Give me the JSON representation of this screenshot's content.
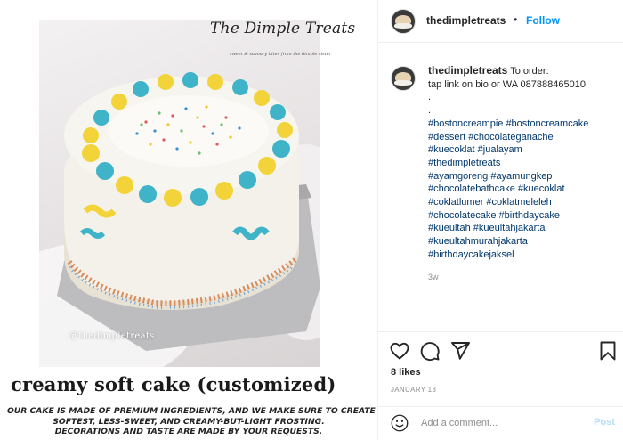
{
  "post_image": {
    "brand_name": "The Dimple Treats",
    "brand_tagline": "sweet & savoury bites from the dimple sister",
    "watermark": "@thedimpletreats",
    "caption_title": "creamy soft cake (customized)",
    "caption_lines": [
      "OUR CAKE IS MADE OF PREMIUM INGREDIENTS, AND WE MAKE SURE TO CREATE THE",
      "SOFTEST, LESS-SWEET, AND CREAMY-BUT-LIGHT FROSTING.",
      "DECORATIONS AND TASTE ARE MADE BY YOUR REQUESTS."
    ]
  },
  "header": {
    "username": "thedimpletreats",
    "separator": "•",
    "follow_label": "Follow"
  },
  "caption": {
    "username": "thedimpletreats",
    "text_lines": [
      "To order:",
      "tap link on bio or WA 087888465010",
      ".",
      ".",
      "#bostoncreampie #bostoncreamcake",
      "#dessert #chocolateganache",
      "#kuecoklat #jualayam",
      "#thedimpletreats",
      "#ayamgoreng #ayamungkep",
      "#chocolatebathcake #kuecoklat",
      "#coklatlumer #coklatmeleleh",
      "#chocolatecake #birthdaycake",
      "#kueultah #kueultahjakarta",
      "#kueultahmurahjakarta",
      "#birthdaycakejaksel"
    ],
    "time_ago": "3w"
  },
  "actions": {
    "likes": "8 likes",
    "date": "JANUARY 13"
  },
  "comment_box": {
    "placeholder": "Add a comment...",
    "post_label": "Post"
  },
  "colors": {
    "link_blue": "#0095f6",
    "hashtag_blue": "#00376b",
    "muted_gray": "#8e8e8e",
    "post_disabled": "#b2dffc",
    "frosting_yellow": "#f2d43a",
    "frosting_teal": "#3fb3c8"
  },
  "icons": [
    "heart-icon",
    "comment-icon",
    "share-icon",
    "bookmark-icon",
    "emoji-icon"
  ]
}
